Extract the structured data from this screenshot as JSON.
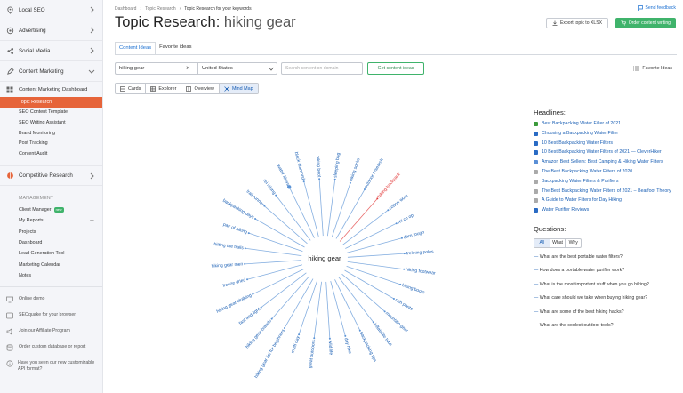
{
  "sidebar": {
    "sections": [
      {
        "label": "Local SEO",
        "icon": "map-pin-icon"
      },
      {
        "label": "Advertising",
        "icon": "target-icon"
      },
      {
        "label": "Social Media",
        "icon": "social-icon"
      },
      {
        "label": "Content Marketing",
        "icon": "content-icon"
      }
    ],
    "content_title": "Content Marketing Dashboard",
    "content_items": [
      "Topic Research",
      "SEO Content Template",
      "SEO Writing Assistant",
      "Brand Monitoring",
      "Post Tracking",
      "Content Audit"
    ],
    "competitive": "Competitive Research",
    "management_label": "MANAGEMENT",
    "management_items": [
      "Client Manager",
      "My Reports",
      "Projects",
      "Dashboard",
      "Lead Generation Tool",
      "Marketing Calendar",
      "Notes"
    ],
    "new_badge": "new",
    "bottom_items": [
      "Online demo",
      "SEOquake for your browser",
      "Join our Affiliate Program",
      "Order custom database or report",
      "Have you seen our new customizable API format?"
    ]
  },
  "breadcrumb": [
    "Dashboard",
    "Topic Research",
    "Topic Research for your keywords"
  ],
  "send_feedback": "Send feedback",
  "title": {
    "prefix": "Topic Research: ",
    "keyword": "hiking gear"
  },
  "buttons": {
    "export": "Export topic to XLSX",
    "order": "Order content writing",
    "get_ideas": "Get content ideas"
  },
  "tabs": [
    "Content Ideas",
    "Favorite ideas"
  ],
  "search": {
    "keyword": "hiking gear",
    "country": "United States",
    "domain_placeholder": "Search content on domain"
  },
  "favorite_ideas": "Favorite Ideas",
  "views": [
    "Cards",
    "Explorer",
    "Overview",
    "Mind Map"
  ],
  "colors": {
    "accent": "#e6643a",
    "link": "#1a5fb4",
    "green": "#3fb36b",
    "highlight": "#e23a3a"
  },
  "mindmap": {
    "center": "hiking gear",
    "highlighted": "hiking backpack",
    "topics": [
      "outdoor research",
      "hiking backpack",
      "cotton wool",
      "rei co op",
      "darn tough",
      "trekking poles",
      "hiking footwear",
      "hiking boots",
      "rain pants",
      "mountain gear",
      "inflatable tubs",
      "backpacking tips",
      "day hike",
      "wild life",
      "great outdoors",
      "multi day",
      "hiking gear list for beginners",
      "hiking gear brands",
      "fast and light",
      "hiking gear clothing",
      "freeze dried",
      "hiking gear men",
      "hitting the trails",
      "pair of hiking",
      "backpacking days",
      "trail runner",
      "rei hiking",
      "water filters",
      "black diamond",
      "hiking boot",
      "sleeping bag",
      "hiking socks"
    ]
  },
  "headlines": {
    "title": "Headlines:",
    "items": [
      "Best Backpacking Water Filter of 2021",
      "Choosing a Backpacking Water Filter",
      "10 Best Backpacking Water Filters",
      "10 Best Backpacking Water Filters of 2021 — CleverHiker",
      "Amazon Best Sellers: Best Camping & Hiking Water Filters",
      "The Best Backpacking Water Filters of 2020",
      "Backpacking Water Filters & Purifiers",
      "The Best Backpacking Water Filters of 2021 – Bearfoot Theory",
      "A Guide to Water Filters for Day Hiking",
      "Water Purifier Reviews"
    ]
  },
  "questions": {
    "title": "Questions:",
    "filters": [
      "All",
      "What",
      "Why"
    ],
    "items": [
      "What are the best portable water filters?",
      "How does a portable water purifier work?",
      "What is the most important stuff when you go hiking?",
      "What care should we take when buying hiking gear?",
      "What are some of the best hiking hacks?",
      "What are the coolest outdoor tools?"
    ]
  }
}
